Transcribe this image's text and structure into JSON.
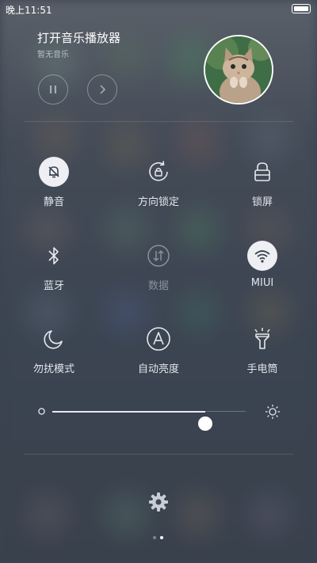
{
  "status_bar": {
    "time": "晚上11:51",
    "battery_level": 1.0
  },
  "music": {
    "title": "打开音乐播放器",
    "subtitle": "暂无音乐",
    "pause_icon": "pause-icon",
    "next_icon": "chevron-right-icon",
    "album_art": "kitten-photo"
  },
  "toggles": [
    {
      "label": "静音",
      "icon": "bell-mute-icon",
      "active": true
    },
    {
      "label": "方向锁定",
      "icon": "rotation-lock-icon",
      "active": false
    },
    {
      "label": "锁屏",
      "icon": "lock-icon",
      "active": false
    },
    {
      "label": "蓝牙",
      "icon": "bluetooth-icon",
      "active": false
    },
    {
      "label": "数据",
      "icon": "mobile-data-icon",
      "active": false,
      "disabled": true
    },
    {
      "label": "MIUI",
      "icon": "wifi-icon",
      "active": true
    },
    {
      "label": "勿扰模式",
      "icon": "moon-icon",
      "active": false
    },
    {
      "label": "自动亮度",
      "icon": "auto-brightness-icon",
      "active": false
    },
    {
      "label": "手电筒",
      "icon": "flashlight-icon",
      "active": false
    }
  ],
  "brightness": {
    "value": 0.79,
    "min_icon": "brightness-low-icon",
    "max_icon": "brightness-high-icon"
  },
  "settings": {
    "icon": "gear-icon"
  },
  "pager": {
    "pages": 2,
    "current": 2
  },
  "colors": {
    "active_toggle_bg": "#edeff2",
    "icon_light": "#e6e9ee",
    "icon_dark": "#3b4451"
  }
}
